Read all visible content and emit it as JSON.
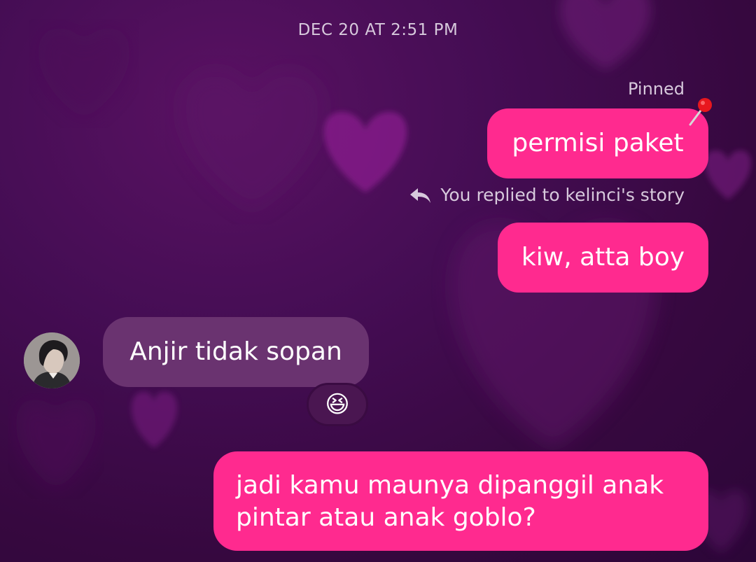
{
  "conversation": {
    "timestamp": "DEC 20 AT 2:51 PM",
    "pinned_label": "Pinned",
    "messages": [
      {
        "sender": "me",
        "text": "permisi paket",
        "pinned": true
      },
      {
        "sender": "me",
        "reply_note": "You replied to kelinci's story",
        "text": "kiw, atta boy"
      },
      {
        "sender": "kelinci",
        "text": "Anjir tidak sopan",
        "reaction": "😆"
      },
      {
        "sender": "me",
        "text_lines": [
          "jadi kamu maunya dipanggil anak",
          "pintar atau anak goblo?"
        ]
      }
    ]
  },
  "icons": {
    "pin": "pushpin-icon",
    "reply": "reply-arrow-icon",
    "avatar": "contact-avatar"
  },
  "colors": {
    "outgoing_bubble": "#ff2a8f",
    "incoming_bubble": "#6a3370",
    "background": "#3a0845",
    "meta_text": "#d7c9dc"
  }
}
